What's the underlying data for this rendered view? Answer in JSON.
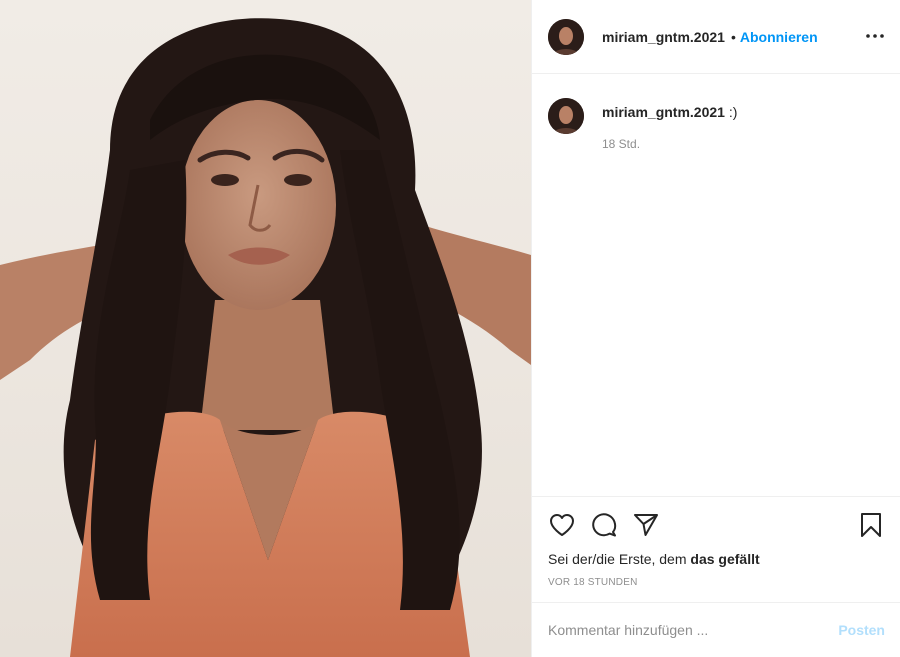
{
  "post": {
    "username": "miriam_gntm.2021",
    "follow_label": "Abonnieren",
    "separator": "•",
    "caption_user": "miriam_gntm.2021",
    "caption_text": ":)",
    "caption_time": "18 Std.",
    "likes_prefix": "Sei der/die Erste, dem ",
    "likes_strong": "das gefällt",
    "time_ago": "VOR 18 STUNDEN"
  },
  "comment_box": {
    "placeholder": "Kommentar hinzufügen ...",
    "post_label": "Posten"
  },
  "icons": {
    "more": "more-horizontal-icon",
    "like": "heart-icon",
    "comment": "comment-bubble-icon",
    "share": "paper-plane-icon",
    "save": "bookmark-icon"
  },
  "colors": {
    "accent": "#0095f6",
    "post_disabled": "#b2dffc",
    "muted": "#8e8e8e",
    "text": "#262626",
    "border": "#efefef"
  }
}
